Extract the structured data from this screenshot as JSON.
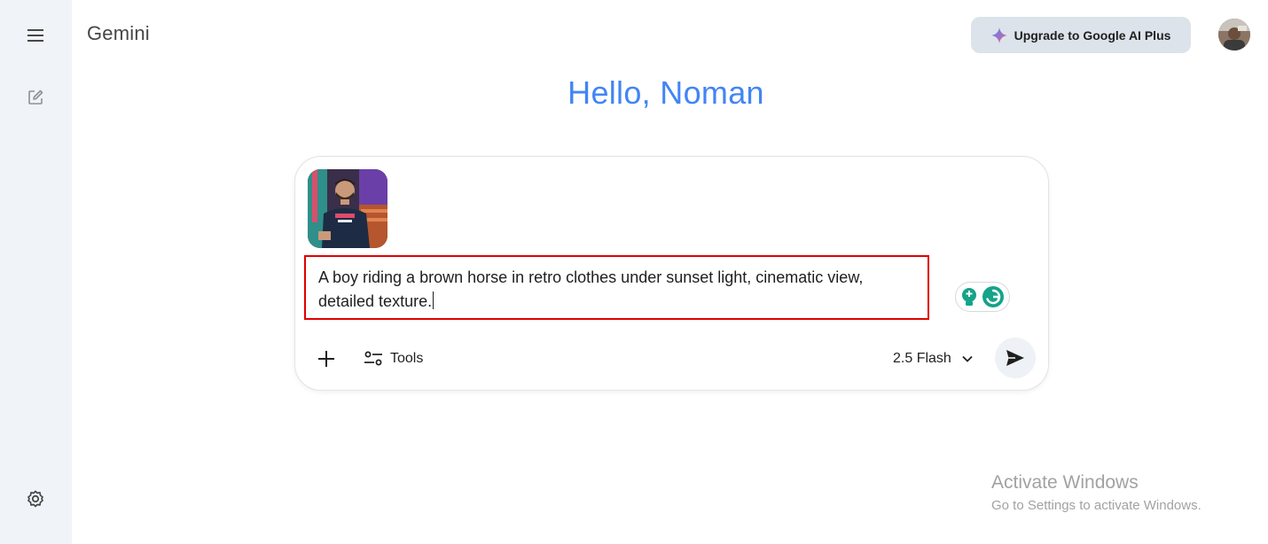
{
  "sidebar": {
    "menu_icon": "hamburger-menu-icon",
    "new_chat_icon": "edit-square-icon",
    "settings_icon": "gear-icon"
  },
  "header": {
    "app_title": "Gemini",
    "upgrade_label": "Upgrade to Google AI Plus",
    "upgrade_icon": "sparkle-icon"
  },
  "main": {
    "greeting": "Hello, Noman"
  },
  "composer": {
    "attachment_icon": "image-thumbnail",
    "prompt_text": "A boy riding a brown horse in retro clothes under sunset light, cinematic view, detailed texture.",
    "add_icon": "plus-icon",
    "tools_label": "Tools",
    "tools_icon": "tune-icon",
    "model_label": "2.5 Flash",
    "model_icon": "chevron-down-icon",
    "send_icon": "send-icon"
  },
  "watermark": {
    "title": "Activate Windows",
    "subtitle": "Go to Settings to activate Windows."
  },
  "colors": {
    "sidebar_bg": "#f0f4f9",
    "greeting": "#4285f4",
    "upgrade_bg": "#dde3ea",
    "highlight_border": "#e00000",
    "grammar_green": "#15a38a"
  }
}
